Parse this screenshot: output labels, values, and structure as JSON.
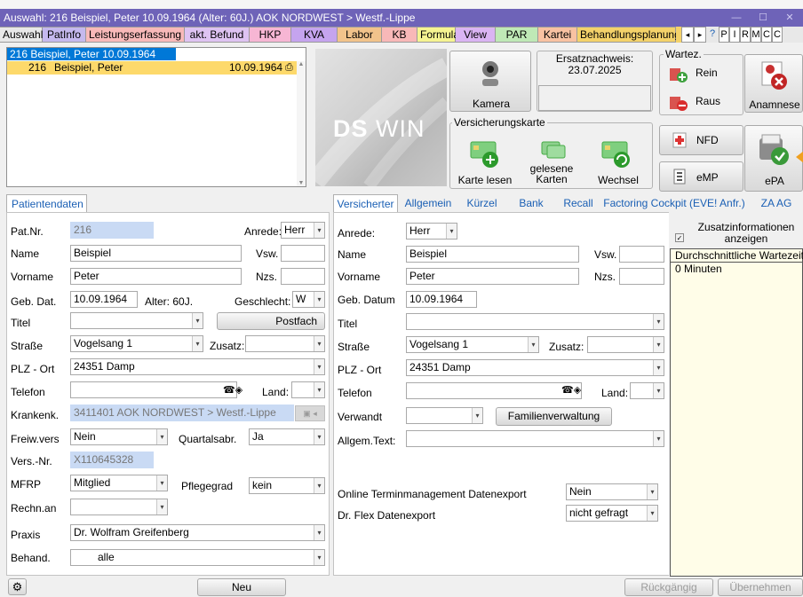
{
  "window": {
    "title": "Auswahl: 216  Beispiel, Peter  10.09.1964 (Alter: 60J.)  AOK NORDWEST > Westf.-Lippe"
  },
  "colors": {
    "titlebar": "#6e63b8",
    "selection": "#0078d7",
    "highlight_row": "#fdd96b",
    "disabled_field": "#c9daf4"
  },
  "tabs": [
    {
      "label": "Auswahl",
      "color": "#e8e8e8"
    },
    {
      "label": "PatInfo",
      "color": "#c5b9ee"
    },
    {
      "label": "Leistungserfassung",
      "color": "#f8b9b9"
    },
    {
      "label": "akt. Befund",
      "color": "#dec3f2"
    },
    {
      "label": "HKP",
      "color": "#f7b6d4"
    },
    {
      "label": "KVA",
      "color": "#c5a4ee"
    },
    {
      "label": "Labor",
      "color": "#f2c38b"
    },
    {
      "label": "KB",
      "color": "#f8b8b8"
    },
    {
      "label": "Formular",
      "color": "#f6f491"
    },
    {
      "label": "View",
      "color": "#dab4f3"
    },
    {
      "label": "PAR",
      "color": "#bfe9b6"
    },
    {
      "label": "Kartei",
      "color": "#f8c2a2"
    },
    {
      "label": "Behandlungsplanung",
      "color": "#f4d26a"
    }
  ],
  "tab_nav": {
    "prev": "◂",
    "next": "▸",
    "help": "?",
    "letters": [
      "P",
      "I",
      "R",
      "M",
      "C",
      "C"
    ]
  },
  "patient_list": {
    "header": "216 Beispiel, Peter  10.09.1964",
    "row": {
      "num": "216",
      "name": "Beispiel, Peter",
      "date": "10.09.1964"
    }
  },
  "logo": {
    "text": "DS WIN"
  },
  "camera": {
    "label": "Kamera"
  },
  "ersatz": {
    "label": "Ersatznachweis:",
    "date": "23.07.2025"
  },
  "wartez": {
    "title": "Wartez.",
    "rein": "Rein",
    "raus": "Raus"
  },
  "anamnese": {
    "label": "Anamnese"
  },
  "vk": {
    "title": "Versicherungskarte",
    "lesen": "Karte lesen",
    "gelesene": "gelesene\nKarten",
    "wechsel": "Wechsel"
  },
  "nfd": {
    "label": "NFD"
  },
  "emp": {
    "label": "eMP"
  },
  "epa": {
    "label": "ePA"
  },
  "left_tab": {
    "label": "Patientendaten"
  },
  "left": {
    "patnr_label": "Pat.Nr.",
    "patnr": "216",
    "anrede_label": "Anrede:",
    "anrede": "Herr",
    "name_label": "Name",
    "name": "Beispiel",
    "vsw_label": "Vsw.",
    "vsw": "",
    "vorname_label": "Vorname",
    "vorname": "Peter",
    "nzs_label": "Nzs.",
    "nzs": "",
    "geb_label": "Geb. Dat.",
    "geb": "10.09.1964",
    "alter": "Alter: 60J.",
    "geschlecht_label": "Geschlecht:",
    "geschlecht": "W",
    "titel_label": "Titel",
    "titel": "",
    "postfach": "Postfach",
    "strasse_label": "Straße",
    "strasse": "Vogelsang 1",
    "zusatz_label": "Zusatz:",
    "zusatz": "",
    "plz_label": "PLZ - Ort",
    "plz": "24351 Damp",
    "telefon_label": "Telefon",
    "telefon": "",
    "land_label": "Land:",
    "land": "",
    "kk_label": "Krankenk.",
    "kk": "3411401 AOK NORDWEST > Westf.-Lippe",
    "freiw_label": "Freiw.vers",
    "freiw": "Nein",
    "quartal_label": "Quartalsabr.",
    "quartal": "Ja",
    "versnr_label": "Vers.-Nr.",
    "versnr": "X110645328",
    "mfrp_label": "MFRP",
    "mfrp": "Mitglied",
    "pflege_label": "Pflegegrad",
    "pflege": "kein",
    "rechn_label": "Rechn.an",
    "rechn": "",
    "praxis_label": "Praxis",
    "praxis": "Dr. Wolfram Greifenberg",
    "behand_label": "Behand.",
    "behand": "alle"
  },
  "right_tabs": [
    "Versicherter",
    "Allgemein",
    "Kürzel",
    "Bank",
    "Recall",
    "Factoring Cockpit (EVE! Anfr.)",
    "ZA AG"
  ],
  "right": {
    "anrede_label": "Anrede:",
    "anrede": "Herr",
    "name_label": "Name",
    "name": "Beispiel",
    "vsw_label": "Vsw.",
    "vsw": "",
    "vorname_label": "Vorname",
    "vorname": "Peter",
    "nzs_label": "Nzs.",
    "nzs": "",
    "geb_label": "Geb. Datum",
    "geb": "10.09.1964",
    "titel_label": "Titel",
    "titel": "",
    "strasse_label": "Straße",
    "strasse": "Vogelsang 1",
    "zusatz_label": "Zusatz:",
    "zusatz": "",
    "plz_label": "PLZ - Ort",
    "plz": "24351 Damp",
    "telefon_label": "Telefon",
    "telefon": "",
    "land_label": "Land:",
    "land": "",
    "verwandt_label": "Verwandt",
    "verwandt": "",
    "familie": "Familienverwaltung",
    "allgem_label": "Allgem.Text:",
    "allgem": "",
    "otm_label": "Online Terminmanagement Datenexport",
    "otm": "Nein",
    "flex_label": "Dr. Flex Datenexport",
    "flex": "nicht gefragt"
  },
  "info": {
    "zusatz_label": "Zusatzinformationen anzeigen",
    "checked": true,
    "wartezeit_title": "Durchschnittliche Wartezeit",
    "wartezeit": "0 Minuten"
  },
  "bottom": {
    "neu": "Neu",
    "rueck": "Rückgängig",
    "uebernehmen": "Übernehmen"
  }
}
